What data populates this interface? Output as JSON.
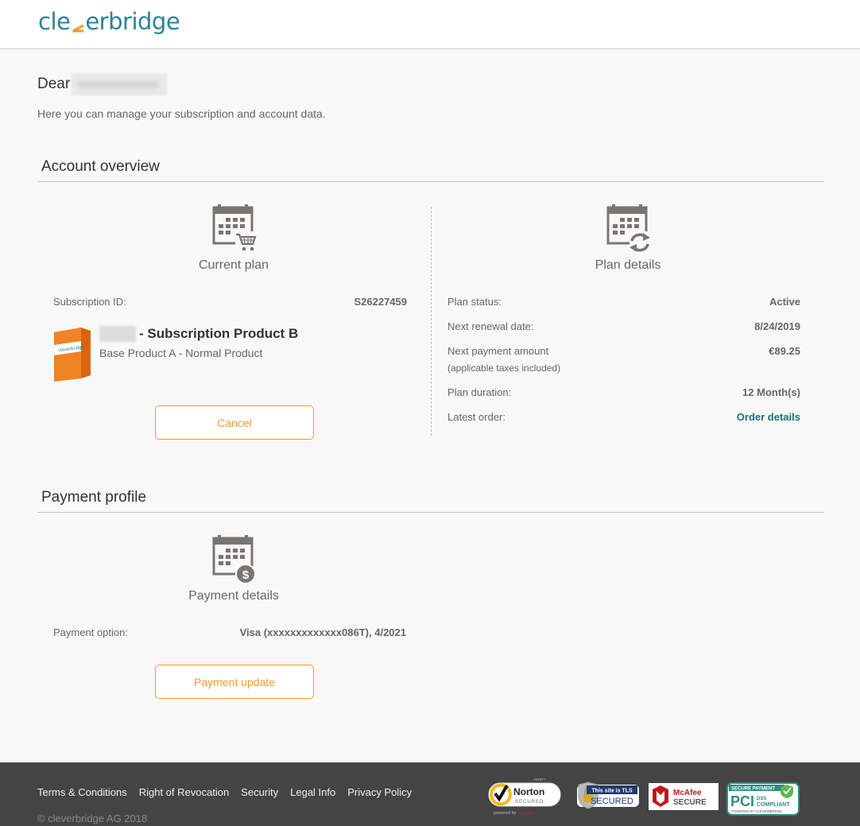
{
  "header": {
    "logo_left": "cle",
    "logo_right": "erbridge",
    "brand_color": "#2d8399",
    "accent_color": "#f39a2e"
  },
  "greeting": {
    "dear": "Dear",
    "intro": "Here you can manage your subscription and account data."
  },
  "account_overview": {
    "title": "Account overview",
    "current_plan": {
      "title": "Current plan",
      "icon": "calendar-cart-icon",
      "subscription_id_label": "Subscription ID:",
      "subscription_id": "S26227459",
      "product_name": "- Subscription Product B",
      "product_sub": "Base Product A - Normal Product",
      "cancel_label": "Cancel"
    },
    "plan_details": {
      "title": "Plan details",
      "icon": "calendar-refresh-icon",
      "rows": [
        {
          "label": "Plan status:",
          "value": "Active"
        },
        {
          "label": "Next renewal date:",
          "value": "8/24/2019"
        },
        {
          "label": "Next payment amount",
          "sub": "(applicable taxes included)",
          "value": "€89.25"
        },
        {
          "label": "Plan duration:",
          "value": "12 Month(s)"
        },
        {
          "label": "Latest order:",
          "value": "Order details"
        }
      ]
    }
  },
  "payment_profile": {
    "title": "Payment profile",
    "details_title": "Payment details",
    "icon": "calendar-dollar-icon",
    "option_label": "Payment option:",
    "option_value": "Visa (xxxxxxxxxxxxx086T), 4/2021",
    "update_label": "Payment update"
  },
  "footer": {
    "links": [
      "Terms & Conditions",
      "Right of Revocation",
      "Security",
      "Legal Info",
      "Privacy Policy"
    ],
    "copyright": "© cleverbridge AG 2018",
    "badges": {
      "norton_verify": "VERIFY",
      "norton_name": "Norton",
      "norton_secured": "SECURED",
      "norton_powered": "powered by",
      "norton_verisign": "VeriSign",
      "tls_top": "This site is TLS",
      "tls_bottom": "SECURED",
      "mcafee_name": "McAfee",
      "mcafee_secure": "SECURE",
      "pci_top": "SECURE PAYMENT",
      "pci_main": "PCI",
      "pci_dss": "DSS",
      "pci_compliant": "COMPLIANT",
      "pci_powered": "POWERED BY CLEVERBRIDGE"
    }
  }
}
